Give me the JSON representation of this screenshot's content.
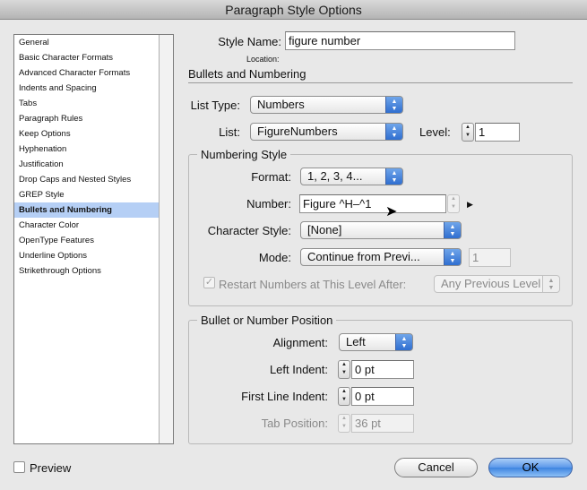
{
  "window": {
    "title": "Paragraph Style Options"
  },
  "sidebar": {
    "items": [
      {
        "label": "General",
        "selected": false
      },
      {
        "label": "Basic Character Formats",
        "selected": false
      },
      {
        "label": "Advanced Character Formats",
        "selected": false
      },
      {
        "label": "Indents and Spacing",
        "selected": false
      },
      {
        "label": "Tabs",
        "selected": false
      },
      {
        "label": "Paragraph Rules",
        "selected": false
      },
      {
        "label": "Keep Options",
        "selected": false
      },
      {
        "label": "Hyphenation",
        "selected": false
      },
      {
        "label": "Justification",
        "selected": false
      },
      {
        "label": "Drop Caps and Nested Styles",
        "selected": false
      },
      {
        "label": "GREP Style",
        "selected": false
      },
      {
        "label": "Bullets and Numbering",
        "selected": true
      },
      {
        "label": "Character Color",
        "selected": false
      },
      {
        "label": "OpenType Features",
        "selected": false
      },
      {
        "label": "Underline Options",
        "selected": false
      },
      {
        "label": "Strikethrough Options",
        "selected": false
      }
    ]
  },
  "header": {
    "style_name_label": "Style Name:",
    "style_name_value": "figure number",
    "location_label": "Location:",
    "section_title": "Bullets and Numbering"
  },
  "list_settings": {
    "list_type_label": "List Type:",
    "list_type_value": "Numbers",
    "list_label": "List:",
    "list_value": "FigureNumbers",
    "level_label": "Level:",
    "level_value": "1"
  },
  "numbering_style": {
    "title": "Numbering Style",
    "format_label": "Format:",
    "format_value": "1, 2, 3, 4...",
    "number_label": "Number:",
    "number_value": "Figure ^H–^1",
    "character_style_label": "Character Style:",
    "character_style_value": "[None]",
    "mode_label": "Mode:",
    "mode_value": "Continue from Previ...",
    "mode_start_value": "1",
    "restart_label": "Restart Numbers at This Level After:",
    "restart_checked": true,
    "restart_value": "Any Previous Level"
  },
  "position": {
    "title": "Bullet or Number Position",
    "alignment_label": "Alignment:",
    "alignment_value": "Left",
    "left_indent_label": "Left Indent:",
    "left_indent_value": "0 pt",
    "first_line_indent_label": "First Line Indent:",
    "first_line_indent_value": "0 pt",
    "tab_position_label": "Tab Position:",
    "tab_position_value": "36 pt"
  },
  "footer": {
    "preview_label": "Preview",
    "cancel_label": "Cancel",
    "ok_label": "OK"
  },
  "colors": {
    "selection": "#b5cff5",
    "popup_accent": "#3d84e0",
    "window_bg": "#e8e8e8"
  }
}
